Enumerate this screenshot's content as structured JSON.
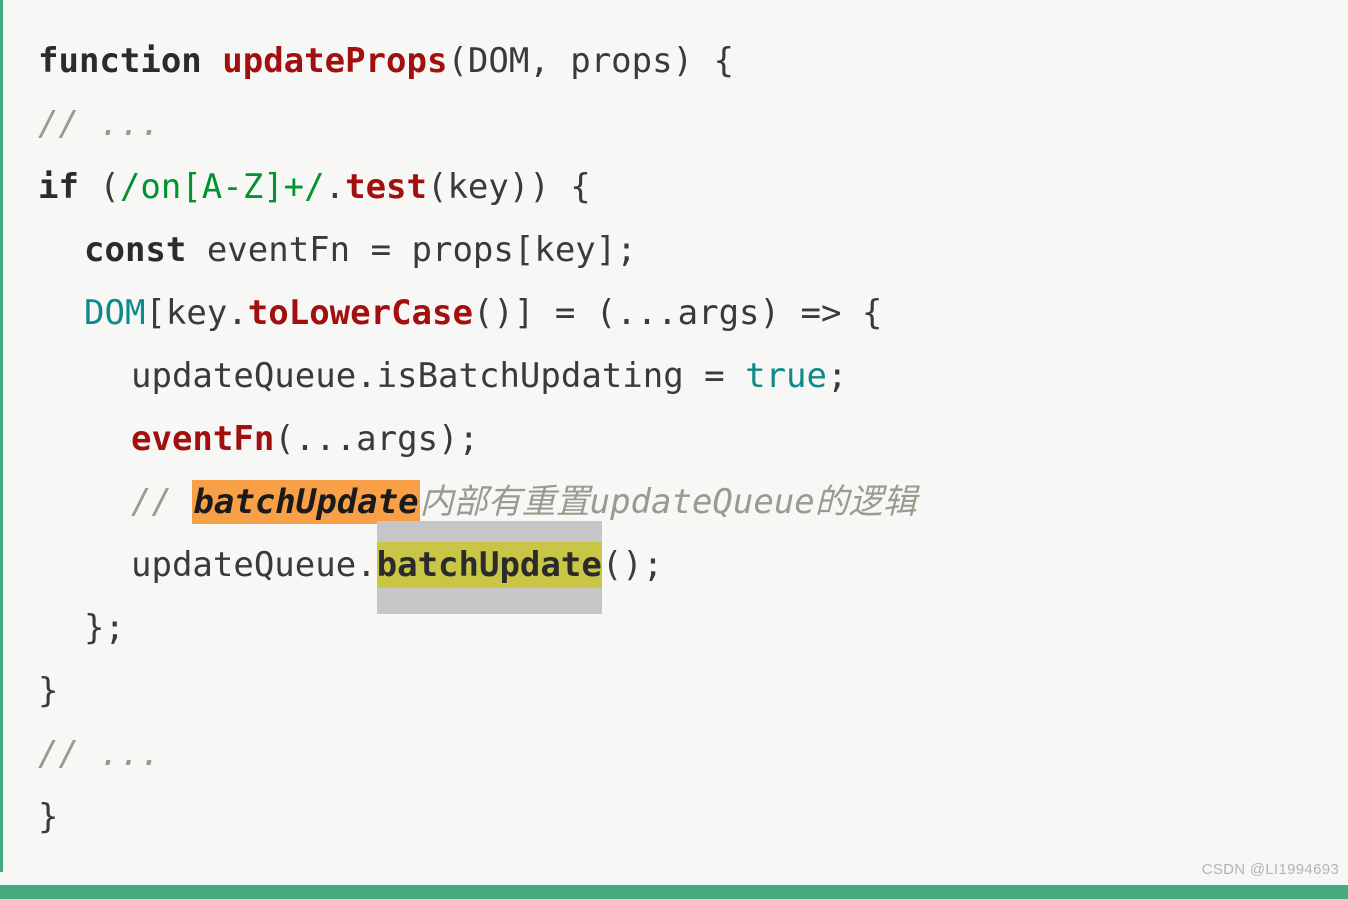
{
  "theme": {
    "background": "#f7f7f5",
    "accent_green": "#45ab7e",
    "text": "#3a3a3a",
    "keyword": "#2b2b2b",
    "function_name": "#a10f0f",
    "regex": "#00932f",
    "constant": "#0e8a8a",
    "comment": "#9a9a8e",
    "highlight_orange": "#f8a048",
    "highlight_olive": "#c9c646",
    "highlight_grey": "#c6c6c6"
  },
  "code": {
    "language": "javascript",
    "lines": [
      {
        "number": 1,
        "indent": 0,
        "text": "function updateProps(DOM, props) {",
        "tokens": [
          {
            "t": "function",
            "k": "kw"
          },
          {
            "t": " ",
            "k": "plain"
          },
          {
            "t": "updateProps",
            "k": "fn"
          },
          {
            "t": "(DOM, props) {",
            "k": "punc"
          }
        ]
      },
      {
        "number": 2,
        "indent": 1,
        "text": "// ...",
        "tokens": [
          {
            "t": "// ...",
            "k": "comment"
          }
        ]
      },
      {
        "number": 3,
        "indent": 1,
        "text": "if (/on[A-Z]+/.test(key)) {",
        "tokens": [
          {
            "t": "if",
            "k": "kw"
          },
          {
            "t": " (",
            "k": "punc"
          },
          {
            "t": "/on[A-Z]+/",
            "k": "regex"
          },
          {
            "t": ".",
            "k": "punc"
          },
          {
            "t": "test",
            "k": "fn"
          },
          {
            "t": "(key)) {",
            "k": "punc"
          }
        ]
      },
      {
        "number": 4,
        "indent": 2,
        "text": "const eventFn = props[key];",
        "tokens": [
          {
            "t": "const",
            "k": "kw"
          },
          {
            "t": " eventFn = props[key];",
            "k": "plain"
          }
        ]
      },
      {
        "number": 5,
        "indent": 2,
        "text": "DOM[key.toLowerCase()] = (...args) => {",
        "tokens": [
          {
            "t": "DOM",
            "k": "teal"
          },
          {
            "t": "[key.",
            "k": "punc"
          },
          {
            "t": "toLowerCase",
            "k": "fn"
          },
          {
            "t": "()] = (...args) => {",
            "k": "punc"
          }
        ]
      },
      {
        "number": 6,
        "indent": 3,
        "text": "updateQueue.isBatchUpdating = true;",
        "tokens": [
          {
            "t": "updateQueue.isBatchUpdating = ",
            "k": "plain"
          },
          {
            "t": "true",
            "k": "teal"
          },
          {
            "t": ";",
            "k": "punc"
          }
        ]
      },
      {
        "number": 7,
        "indent": 3,
        "text": "eventFn(...args);",
        "tokens": [
          {
            "t": "eventFn",
            "k": "fn"
          },
          {
            "t": "(...args);",
            "k": "punc"
          }
        ]
      },
      {
        "number": 8,
        "indent": 3,
        "text": "// batchUpdate内部有重置updateQueue的逻辑",
        "highlight": "orange",
        "tokens": [
          {
            "t": "// ",
            "k": "comment"
          },
          {
            "t": "batchUpdate",
            "k": "hl-orange"
          },
          {
            "t": "内部有重置updateQueue的逻辑",
            "k": "comment"
          }
        ]
      },
      {
        "number": 9,
        "indent": 3,
        "text": "updateQueue.batchUpdate();",
        "highlight": "olive",
        "tokens": [
          {
            "t": "updateQueue.",
            "k": "plain"
          },
          {
            "t": "batchUpdate",
            "k": "hl-olive"
          },
          {
            "t": "();",
            "k": "punc"
          }
        ]
      },
      {
        "number": 10,
        "indent": 2,
        "text": "};",
        "tokens": [
          {
            "t": "};",
            "k": "punc"
          }
        ]
      },
      {
        "number": 11,
        "indent": 1,
        "text": "}",
        "tokens": [
          {
            "t": "}",
            "k": "punc"
          }
        ]
      },
      {
        "number": 12,
        "indent": 1,
        "text": "// ...",
        "tokens": [
          {
            "t": "// ...",
            "k": "comment"
          }
        ]
      },
      {
        "number": 13,
        "indent": 0,
        "text": "}",
        "tokens": [
          {
            "t": "}",
            "k": "punc"
          }
        ]
      }
    ]
  },
  "line1": {
    "kw": "function",
    "space": " ",
    "name": "updateProps",
    "rest": "(DOM, props) {"
  },
  "line2": {
    "comment": "// ..."
  },
  "line3": {
    "kw": "if",
    "open": " (",
    "regex": "/on[A-Z]+/",
    "dot": ".",
    "method": "test",
    "rest": "(key)) {"
  },
  "line4": {
    "kw": "const",
    "rest": " eventFn = props[key];"
  },
  "line5": {
    "obj": "DOM",
    "bracket": "[key.",
    "method": "toLowerCase",
    "rest": "()] = (...args) => {"
  },
  "line6": {
    "head": "updateQueue.isBatchUpdating = ",
    "bool": "true",
    "semi": ";"
  },
  "line7": {
    "fn": "eventFn",
    "rest": "(...args);"
  },
  "line8": {
    "slashes": "// ",
    "mark": "batchUpdate",
    "tail": "内部有重置updateQueue的逻辑"
  },
  "line9": {
    "head": "updateQueue.",
    "mark": "batchUpdate",
    "tail": "();"
  },
  "line10": {
    "text": "};"
  },
  "line11": {
    "text": "}"
  },
  "line12": {
    "comment": "// ..."
  },
  "line13": {
    "text": "}"
  },
  "watermark": {
    "text": "CSDN @LI1994693"
  }
}
